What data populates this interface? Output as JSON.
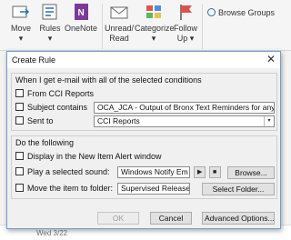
{
  "ribbon": {
    "move": "Move",
    "rules": "Rules",
    "onenote": "OneNote",
    "unread_read": [
      "Unread/",
      "Read"
    ],
    "categorize": "Categorize",
    "follow_up": [
      "Follow",
      "Up"
    ],
    "browse_groups": "Browse Groups",
    "dropdown_arrow": "▾"
  },
  "dialog": {
    "title": "Create Rule",
    "close": "✕",
    "conditions": {
      "heading": "When I get e-mail with all of the selected conditions",
      "from_label": "From CCI Reports",
      "subject_label": "Subject contains",
      "subject_value": "OCA_JCA - Output of Bronx Text Reminders for anyone w",
      "sent_to_label": "Sent to",
      "sent_to_value": "CCI Reports"
    },
    "actions": {
      "heading": "Do the following",
      "display_alert_label": "Display in the New Item Alert window",
      "play_sound_label": "Play a selected sound:",
      "sound_value": "Windows Notify Em",
      "play_icon": "▶",
      "stop_icon": "■",
      "browse_button": "Browse...",
      "move_label": "Move the item to folder:",
      "folder_value": "Supervised Release",
      "select_folder_button": "Select Folder..."
    },
    "buttons": {
      "ok": "OK",
      "cancel": "Cancel",
      "advanced": "Advanced Options..."
    }
  },
  "background": {
    "date": "Wed 3/22"
  },
  "colors": {
    "accent_blue": "#2b6fb6",
    "onenote_purple": "#7b3a98",
    "follow_flag_red": "#d9534f",
    "dialog_border": "#6f9ed6"
  }
}
